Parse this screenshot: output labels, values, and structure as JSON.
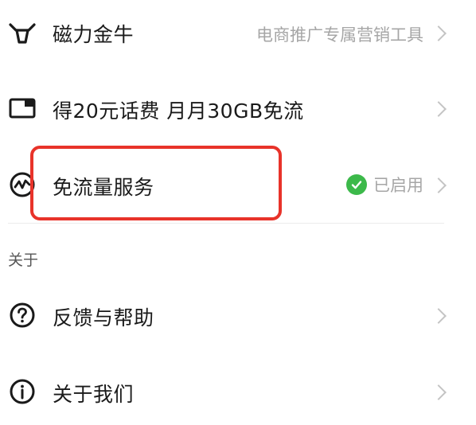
{
  "rows": {
    "magnet_bull": {
      "label": "磁力金牛",
      "subtitle": "电商推广专属营销工具",
      "icon": "bull-icon"
    },
    "phone_credit": {
      "label": "得20元话费 月月30GB免流",
      "icon": "card-icon"
    },
    "data_free_service": {
      "label": "免流量服务",
      "status": "已启用",
      "icon": "pulse-icon"
    }
  },
  "about_section": {
    "header": "关于",
    "items": [
      {
        "label": "反馈与帮助",
        "icon": "question-icon"
      },
      {
        "label": "关于我们",
        "icon": "info-icon"
      }
    ]
  },
  "colors": {
    "highlight": "#e8332a",
    "status_check": "#3cb94a",
    "secondary_text": "#a6a6a6"
  }
}
